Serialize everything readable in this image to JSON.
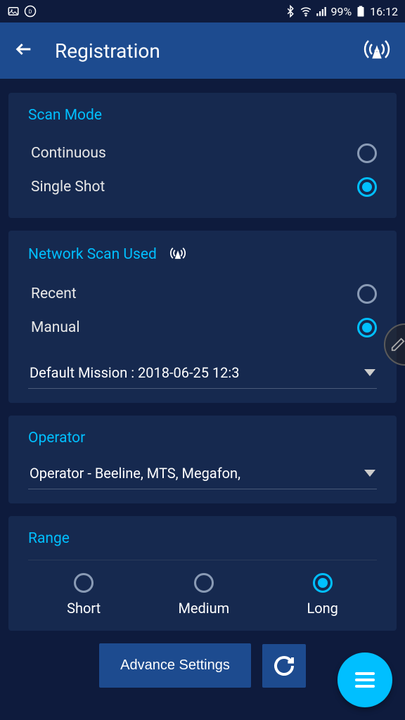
{
  "status": {
    "battery": "99%",
    "time": "16:12"
  },
  "header": {
    "title": "Registration"
  },
  "scanMode": {
    "title": "Scan Mode",
    "options": [
      "Continuous",
      "Single Shot"
    ],
    "selected": 1
  },
  "networkScan": {
    "title": "Network Scan Used",
    "options": [
      "Recent",
      "Manual"
    ],
    "selected": 1,
    "dropdown": "Default Mission : 2018-06-25 12:3"
  },
  "operator": {
    "title": "Operator",
    "dropdown": "Operator - Beeline, MTS, Megafon,"
  },
  "range": {
    "title": "Range",
    "options": [
      "Short",
      "Medium",
      "Long"
    ],
    "selected": 2
  },
  "buttons": {
    "advance": "Advance Settings"
  }
}
